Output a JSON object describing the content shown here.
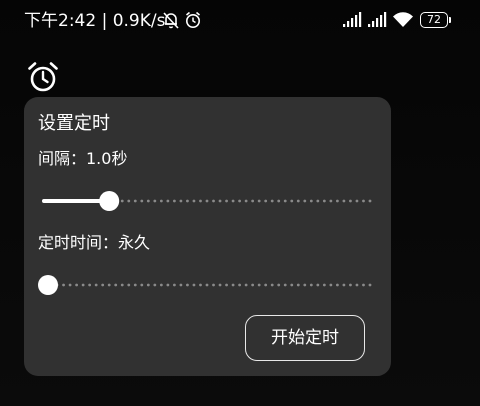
{
  "status_bar": {
    "text": "下午2:42 | 0.9K/s",
    "battery": "72",
    "icons": [
      "mute-bell-icon",
      "alarm-icon",
      "signal-icon",
      "signal-icon",
      "wifi-icon",
      "battery-icon"
    ]
  },
  "app": {
    "floating_icon": "alarm-clock-icon"
  },
  "dialog": {
    "title": "设置定时",
    "interval_label": "间隔：1.0秒",
    "interval_slider": {
      "value": 0.2,
      "ticks": 50
    },
    "duration_label": "定时时间：永久",
    "duration_slider": {
      "value": 0.0,
      "ticks": 50
    },
    "start_button_label": "开始定时"
  },
  "colors": {
    "background": "#000000",
    "card": "#313131",
    "foreground": "#ffffff",
    "slider_dots": "#8a8a8a"
  }
}
